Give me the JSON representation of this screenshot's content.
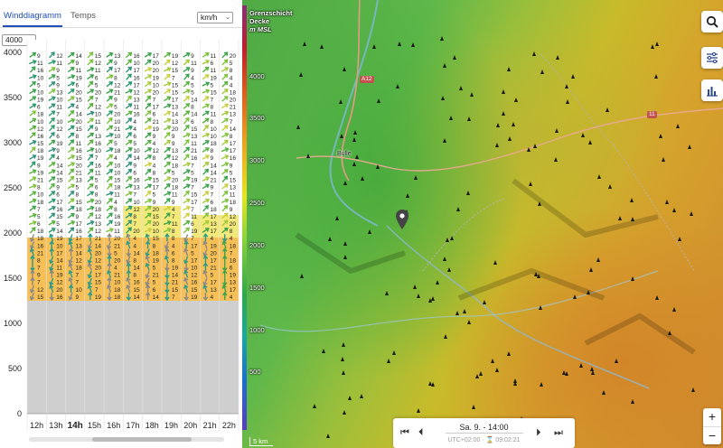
{
  "tabs": [
    {
      "label": "Winddiagramm",
      "active": true
    },
    {
      "label": "Temps",
      "active": false
    }
  ],
  "unit_select": {
    "value": "km/h"
  },
  "altitude_select": {
    "value": "4000"
  },
  "wind_chart": {
    "y_ticks": [
      "4000",
      "3500",
      "3000",
      "2500",
      "2000",
      "1500",
      "1000",
      "500",
      "0"
    ],
    "hours": [
      "12h",
      "13h",
      "14h",
      "15h",
      "16h",
      "17h",
      "18h",
      "19h",
      "20h",
      "21h",
      "22h"
    ],
    "selected_hour": "14h",
    "top_row_speeds": [
      "9",
      "12",
      "14",
      "15",
      "13",
      "16",
      "17",
      "19",
      "9",
      "11"
    ],
    "colors": {
      "terrain": "#cfcfcf",
      "boundary_layer": "#f6c057",
      "boundary_layer_light": "#f3e97a"
    }
  },
  "map": {
    "legend_title": [
      "Grenzschicht",
      "Decke",
      "m MSL"
    ],
    "legend_labels": [
      "4000",
      "3500",
      "3000",
      "2500",
      "2000",
      "1500",
      "1000",
      "500"
    ],
    "road_labels": [
      "A12",
      "11"
    ],
    "town_label": "Bulle",
    "scale_label": "5 km",
    "zoom_in": "+",
    "zoom_out": "−"
  },
  "time_control": {
    "date": "Sa. 9. - 14:00",
    "utc": "UTC+02:00 · ⌛ 09:02:21"
  },
  "icons": [
    "search-icon",
    "sliders-icon",
    "bar-chart-icon",
    "map-pin-icon",
    "skip-back-icon",
    "step-back-icon",
    "step-forward-icon",
    "skip-forward-icon"
  ]
}
